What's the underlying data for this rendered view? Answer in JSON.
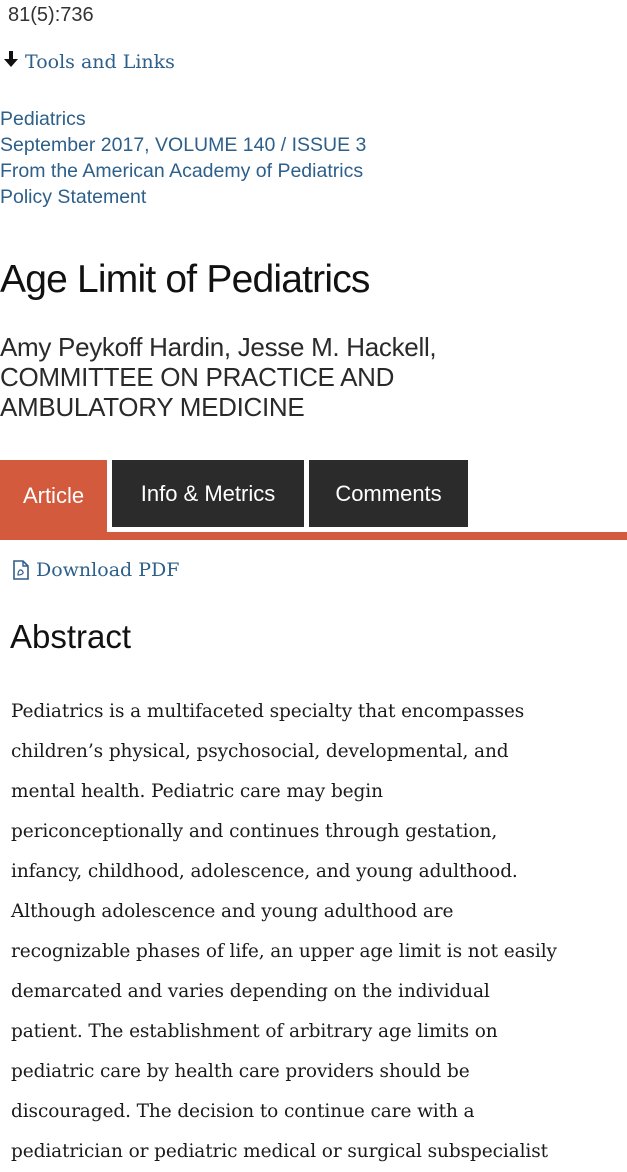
{
  "citation": "81(5):736",
  "tools_links": {
    "label": "Tools and Links",
    "icon": "arrow-down-icon"
  },
  "journal": {
    "name": "Pediatrics",
    "issue": "September 2017, VOLUME 140 / ISSUE 3",
    "source": "From the American Academy of Pediatrics",
    "type": "Policy Statement"
  },
  "article": {
    "title": "Age Limit of Pediatrics",
    "authors_lines": [
      "Amy Peykoff Hardin, Jesse M. Hackell,",
      "COMMITTEE ON PRACTICE AND",
      "AMBULATORY MEDICINE"
    ]
  },
  "tabs": [
    {
      "label": "Article",
      "active": true
    },
    {
      "label": "Info & Metrics",
      "active": false
    },
    {
      "label": "Comments",
      "active": false
    }
  ],
  "download_pdf": {
    "label": "Download PDF",
    "icon": "pdf-document-icon"
  },
  "abstract": {
    "heading": "Abstract",
    "lines": [
      "Pediatrics is a multifaceted specialty that encompasses",
      "children’s physical, psychosocial, developmental, and",
      "mental health. Pediatric care may begin",
      "periconceptionally and continues through gestation,",
      "infancy, childhood, adolescence, and young adulthood.",
      "Although adolescence and young adulthood are",
      "recognizable phases of life, an upper age limit is not easily",
      "demarcated and varies depending on the individual",
      "patient. The establishment of arbitrary age limits on",
      "pediatric care by health care providers should be",
      "discouraged. The decision to continue care with a",
      "pediatrician or pediatric medical or surgical subspecialist"
    ]
  },
  "colors": {
    "link": "#2d5f8b",
    "accent": "#d35a3c",
    "tab_dark": "#2b2b2b"
  }
}
